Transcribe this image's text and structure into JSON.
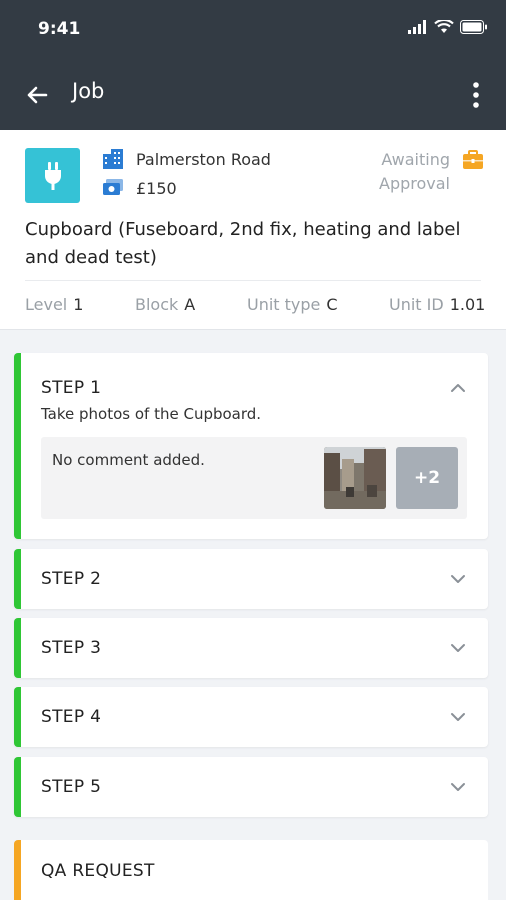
{
  "status_bar": {
    "time": "9:41"
  },
  "header": {
    "title": "Job"
  },
  "job": {
    "location": "Palmerston Road",
    "price": "£150",
    "status_line1": "Awaiting",
    "status_line2": "Approval",
    "title": "Cupboard (Fuseboard, 2nd fix, heating and label and dead test)",
    "attributes": [
      {
        "label": "Level",
        "value": "1"
      },
      {
        "label": "Block",
        "value": "A"
      },
      {
        "label": "Unit type",
        "value": "C"
      },
      {
        "label": "Unit ID",
        "value": "1.01"
      }
    ]
  },
  "steps": [
    {
      "title": "STEP 1",
      "expanded": true,
      "description": "Take photos of the Cupboard.",
      "comment": "No comment added.",
      "more_photos": "+2"
    },
    {
      "title": "STEP 2",
      "expanded": false
    },
    {
      "title": "STEP 3",
      "expanded": false
    },
    {
      "title": "STEP 4",
      "expanded": false
    },
    {
      "title": "STEP 5",
      "expanded": false
    }
  ],
  "qa": {
    "title": "QA REQUEST"
  },
  "colors": {
    "header_bg": "#333b44",
    "job_icon_bg": "#35c2d6",
    "step_accent": "#2fc635",
    "qa_accent": "#f5a623",
    "status_icon": "#f5a623",
    "meta_icon": "#2b7cd3"
  },
  "icons": {
    "back": "arrow-left-icon",
    "more": "more-vertical-icon",
    "job_type": "plug-icon",
    "location": "building-icon",
    "price": "money-icon",
    "status": "briefcase-icon",
    "expand": "chevron-down-icon",
    "collapse": "chevron-up-icon"
  }
}
